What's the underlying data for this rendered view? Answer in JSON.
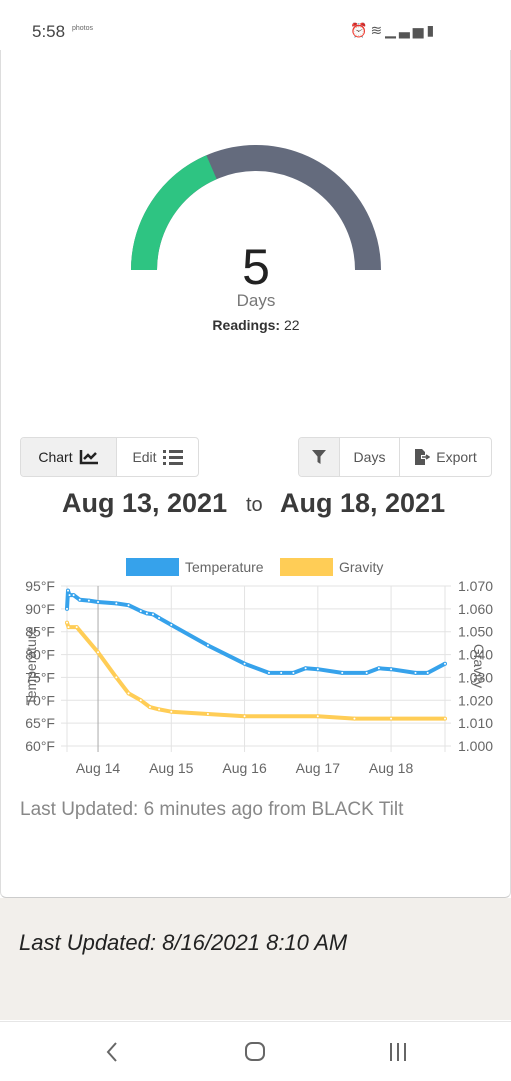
{
  "status_bar": {
    "time": "5:58",
    "notification": "photos",
    "icons": [
      "alarm-icon",
      "wifi-icon",
      "signal-icon",
      "battery-icon"
    ]
  },
  "gauge": {
    "value": "5",
    "unit": "Days",
    "readings_label": "Readings:",
    "readings_value": "22",
    "fill_fraction": 0.37,
    "fill_color": "#2ec482",
    "track_color": "#646b7d"
  },
  "toolbar": {
    "chart_label": "Chart",
    "edit_label": "Edit",
    "days_label": "Days",
    "export_label": "Export"
  },
  "range": {
    "start": "Aug 13, 2021",
    "to": "to",
    "end": "Aug 18, 2021"
  },
  "chart_data": {
    "type": "line",
    "legend": "top",
    "grid": true,
    "x_ticks": [
      "Aug 14",
      "Aug 15",
      "Aug 16",
      "Aug 17",
      "Aug 18"
    ],
    "x_tick_values": [
      "2021-08-14T00:00",
      "2021-08-15T00:00",
      "2021-08-16T00:00",
      "2021-08-17T00:00",
      "2021-08-18T00:00"
    ],
    "xlim": [
      "2021-08-13T13:50",
      "2021-08-18T17:40"
    ],
    "y_left": {
      "label": "Temperature",
      "ticks": [
        "60°F",
        "65°F",
        "70°F",
        "75°F",
        "80°F",
        "85°F",
        "90°F",
        "95°F"
      ],
      "lim": [
        60,
        95
      ]
    },
    "y_right": {
      "label": "Gravity",
      "ticks": [
        "1.000",
        "1.010",
        "1.020",
        "1.030",
        "1.040",
        "1.050",
        "1.060",
        "1.070"
      ],
      "lim": [
        1.0,
        1.07
      ]
    },
    "series": [
      {
        "name": "Temperature",
        "axis": "left",
        "color": "#36a2eb",
        "x": [
          "2021-08-13T13:50",
          "2021-08-13T14:10",
          "2021-08-13T14:40",
          "2021-08-13T16:00",
          "2021-08-13T18:00",
          "2021-08-13T21:00",
          "2021-08-14T00:00",
          "2021-08-14T06:00",
          "2021-08-14T10:00",
          "2021-08-14T14:00",
          "2021-08-14T16:00",
          "2021-08-14T18:00",
          "2021-08-14T20:00",
          "2021-08-15T00:00",
          "2021-08-15T12:00",
          "2021-08-16T00:00",
          "2021-08-16T08:00",
          "2021-08-16T12:00",
          "2021-08-16T16:00",
          "2021-08-16T20:00",
          "2021-08-17T00:00",
          "2021-08-17T08:00",
          "2021-08-17T16:00",
          "2021-08-17T20:00",
          "2021-08-18T00:00",
          "2021-08-18T08:00",
          "2021-08-18T12:00",
          "2021-08-18T17:40"
        ],
        "y": [
          90,
          94,
          93,
          93,
          92,
          91.8,
          91.5,
          91.2,
          90.8,
          89.5,
          89,
          88.8,
          88,
          86.5,
          82,
          78,
          76,
          76,
          76,
          77,
          76.8,
          76,
          76,
          77,
          76.8,
          76,
          76,
          78
        ]
      },
      {
        "name": "Gravity",
        "axis": "right",
        "color": "#ffcd56",
        "x": [
          "2021-08-13T13:50",
          "2021-08-13T14:20",
          "2021-08-13T17:00",
          "2021-08-14T00:00",
          "2021-08-14T06:00",
          "2021-08-14T10:00",
          "2021-08-14T14:00",
          "2021-08-14T17:00",
          "2021-08-14T20:00",
          "2021-08-15T00:00",
          "2021-08-15T12:00",
          "2021-08-16T00:00",
          "2021-08-17T00:00",
          "2021-08-17T12:00",
          "2021-08-18T00:00",
          "2021-08-18T17:40"
        ],
        "y": [
          1.054,
          1.052,
          1.052,
          1.041,
          1.03,
          1.023,
          1.02,
          1.017,
          1.016,
          1.015,
          1.014,
          1.013,
          1.013,
          1.012,
          1.012,
          1.012
        ]
      }
    ]
  },
  "last_updated_relative": "Last Updated: 6 minutes ago from BLACK Tilt",
  "footer": {
    "last_updated": "Last Updated: 8/16/2021 8:10 AM"
  }
}
